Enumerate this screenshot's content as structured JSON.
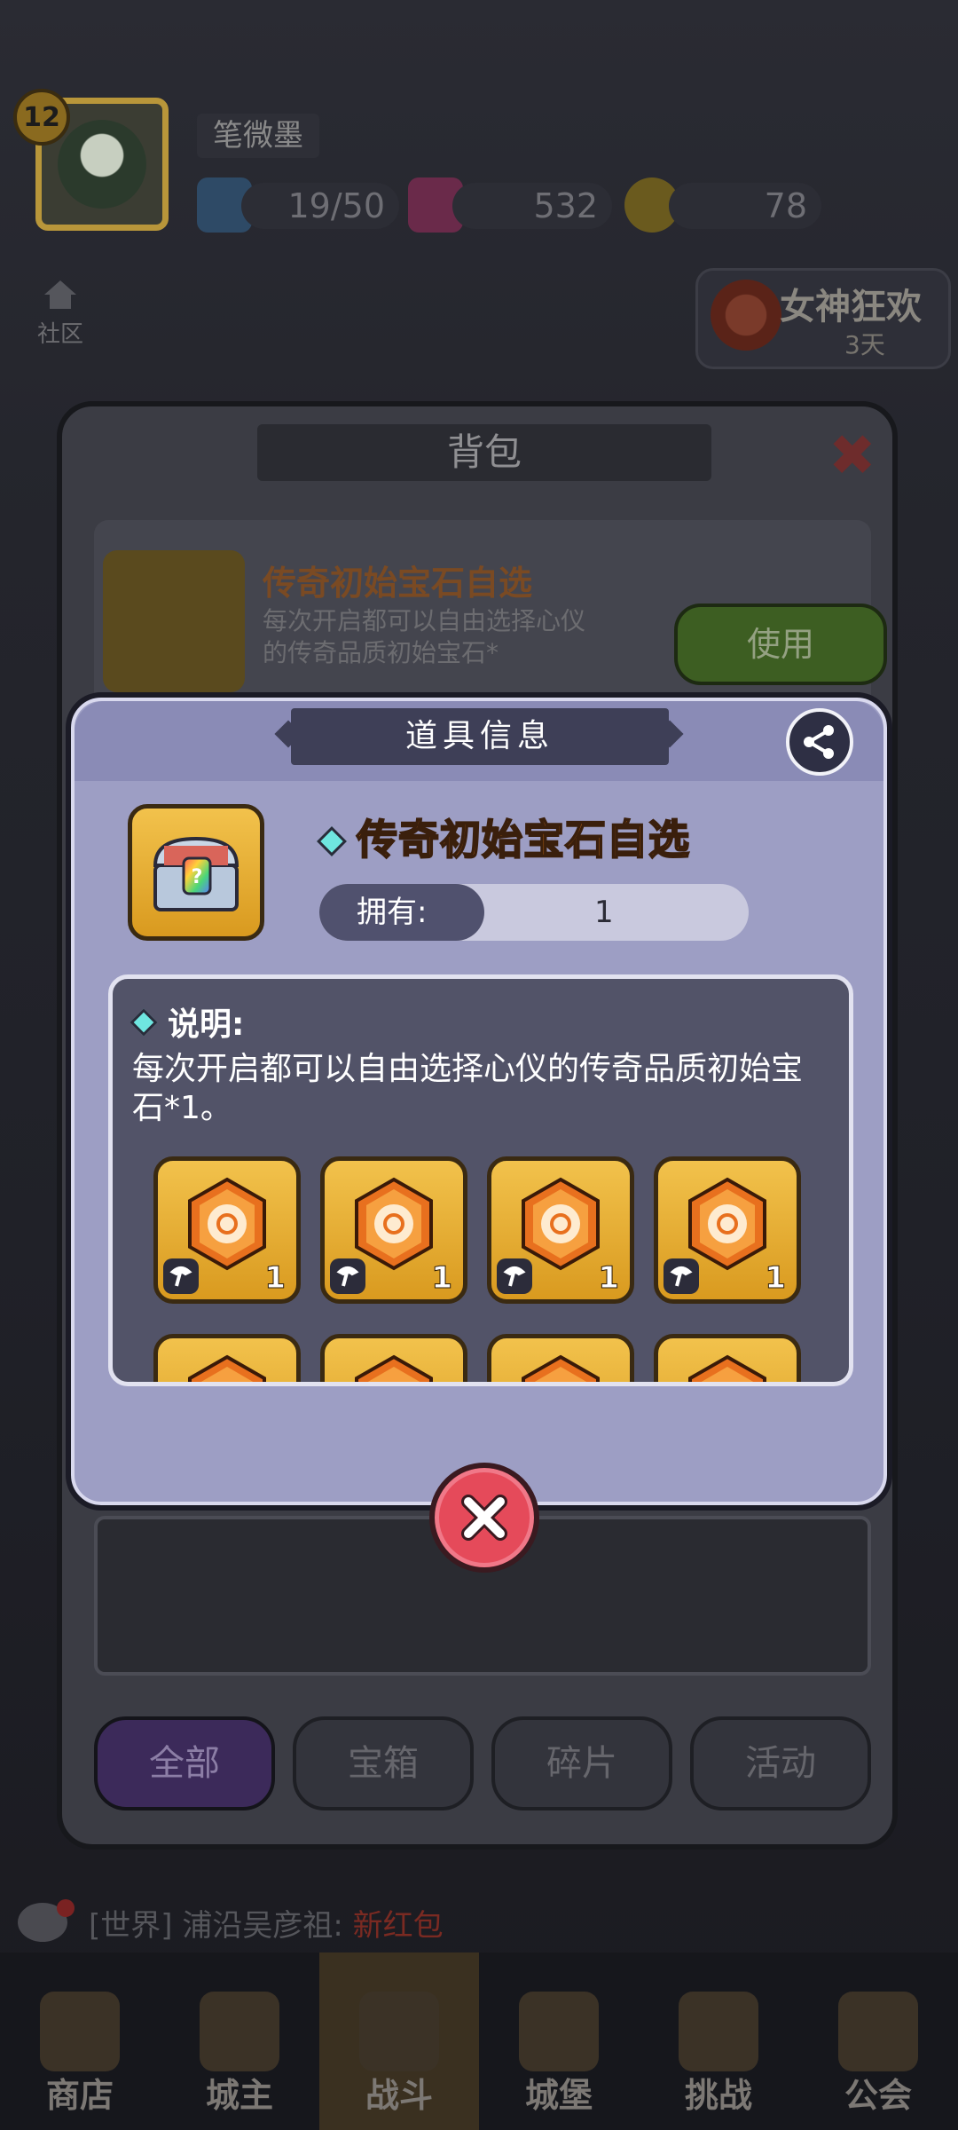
{
  "player": {
    "level": "12",
    "name": "笔微墨",
    "energy": "19/50",
    "gems": "532",
    "coins": "78"
  },
  "side": {
    "community": "社区",
    "event_title": "女神狂欢",
    "event_days": "3天"
  },
  "bag": {
    "title": "背包",
    "item_name": "传奇初始宝石自选",
    "item_desc": "每次开启都可以自由选择心仪的传奇品质初始宝石*",
    "use_button": "使用",
    "tabs": [
      "全部",
      "宝箱",
      "碎片",
      "活动"
    ]
  },
  "chat": {
    "channel": "[世界]",
    "sender": "浦沿吴彦祖:",
    "message": "新红包"
  },
  "nav": {
    "items": [
      "商店",
      "城主",
      "战斗",
      "城堡",
      "挑战",
      "公会"
    ]
  },
  "modal": {
    "title": "道具信息",
    "item_name": "传奇初始宝石自选",
    "own_label": "拥有:",
    "own_value": "1",
    "desc_title": "说明:",
    "desc_text": "每次开启都可以自由选择心仪的传奇品质初始宝石*1。",
    "gems": [
      {
        "qty": "1"
      },
      {
        "qty": "1"
      },
      {
        "qty": "1"
      },
      {
        "qty": "1"
      },
      {
        "qty": ""
      },
      {
        "qty": ""
      },
      {
        "qty": ""
      },
      {
        "qty": ""
      }
    ]
  },
  "colors": {
    "accent_orange": "#ff8a1e",
    "modal_bg": "#9d9ec4",
    "close_red": "#e54a5a"
  }
}
